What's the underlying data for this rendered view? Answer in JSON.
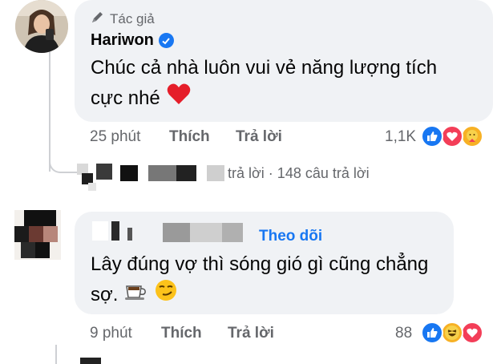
{
  "comment1": {
    "tag": "Tác giả",
    "author": "Hariwon",
    "text_line1": "Chúc cả nhà luôn vui vẻ năng lượng tích",
    "text_line2": "cực nhé",
    "text_emoji": "❤️",
    "time": "25 phút",
    "like": "Thích",
    "reply": "Trả lời",
    "reaction_count": "1,1K",
    "reactions": [
      "like-icon",
      "love-icon",
      "care-icon"
    ]
  },
  "reply_summary": {
    "text": "trả lời · 148 câu trả lời"
  },
  "comment2": {
    "follow": "Theo dõi",
    "text_line1": "Lây đúng vợ thì sóng gió gì cũng chẳng",
    "text_line2": "sợ.",
    "text_emojis": "☕ 😏",
    "time": "9 phút",
    "like": "Thích",
    "reply": "Trả lời",
    "reaction_count": "88",
    "reactions": [
      "like-icon",
      "haha-icon",
      "love-icon"
    ]
  },
  "colors": {
    "bubble": "#f0f2f5",
    "meta": "#65676b",
    "accent": "#1877f2"
  }
}
